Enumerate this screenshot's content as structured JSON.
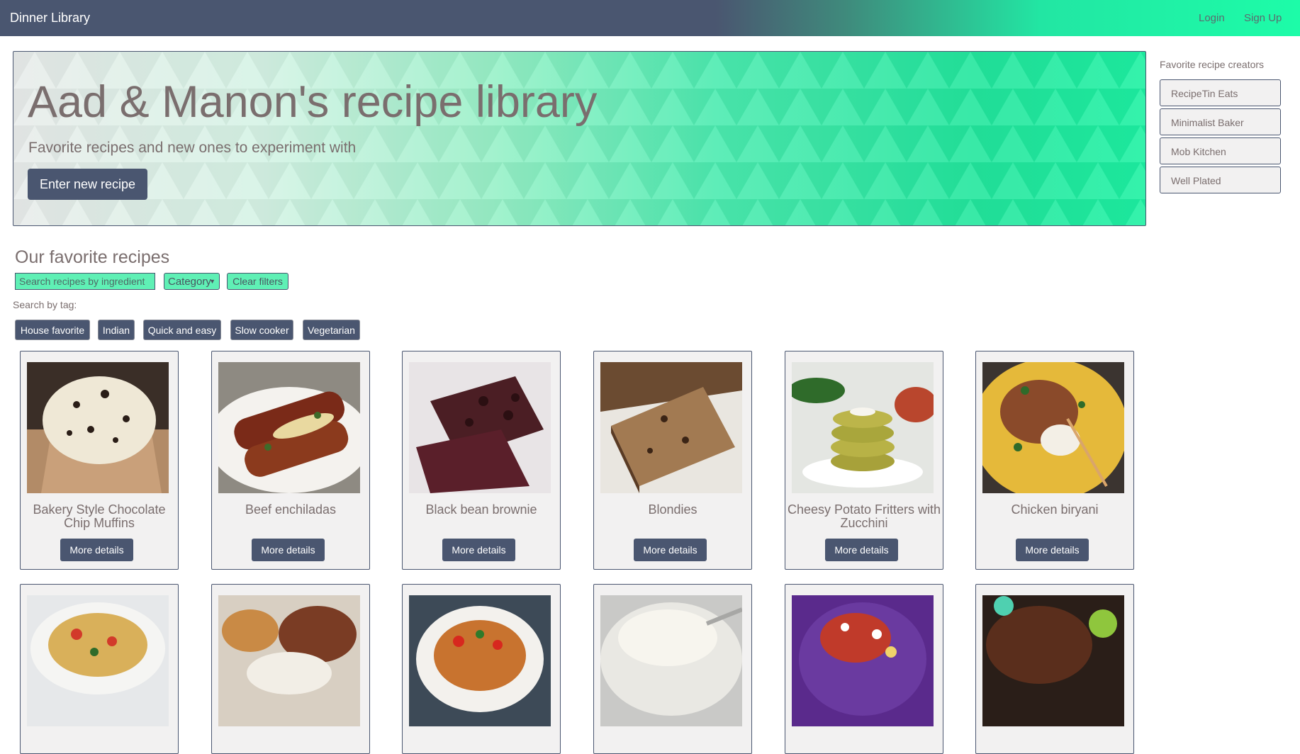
{
  "navbar": {
    "brand": "Dinner Library",
    "login": "Login",
    "signup": "Sign Up"
  },
  "hero": {
    "title": "Aad & Manon's recipe library",
    "subtitle": "Favorite recipes and new ones to experiment with",
    "button": "Enter new recipe"
  },
  "sidebar": {
    "title": "Favorite recipe creators",
    "creators": [
      "RecipeTin Eats",
      "Minimalist Baker",
      "Mob Kitchen",
      "Well Plated"
    ]
  },
  "recipes_section": {
    "title": "Our favorite recipes",
    "search_placeholder": "Search recipes by ingredient",
    "category_label": "Category",
    "clear_label": "Clear filters",
    "tag_label": "Search by tag:",
    "tags": [
      "House favorite",
      "Indian",
      "Quick and easy",
      "Slow cooker",
      "Vegetarian"
    ]
  },
  "recipes": [
    {
      "title": "Bakery Style Chocolate Chip Muffins",
      "button": "More details"
    },
    {
      "title": "Beef enchiladas",
      "button": "More details"
    },
    {
      "title": "Black bean brownie",
      "button": "More details"
    },
    {
      "title": "Blondies",
      "button": "More details"
    },
    {
      "title": "Cheesy Potato Fritters with Zucchini",
      "button": "More details"
    },
    {
      "title": "Chicken biryani",
      "button": "More details"
    }
  ],
  "colors": {
    "primary": "#4a5670",
    "accent": "#1dfca8",
    "filter_bg": "#5ff0b5",
    "card_bg": "#f2f1f1",
    "text": "#7a6e6e"
  }
}
